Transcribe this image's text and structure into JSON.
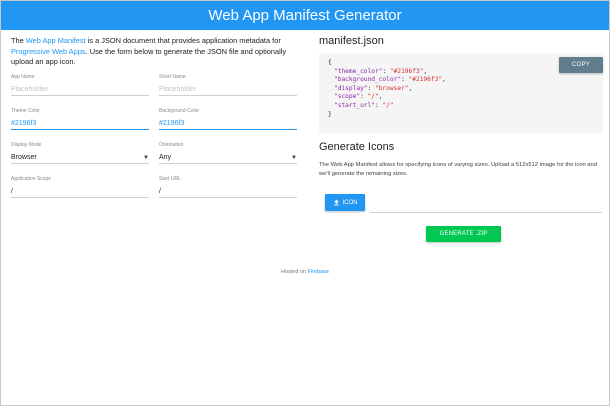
{
  "header": {
    "title": "Web App Manifest Generator"
  },
  "intro": {
    "part1": "The ",
    "link1": "Web App Manifest",
    "part2": " is a JSON document that provides application metadata for ",
    "link2": "Progressive Web Apps",
    "part3": ". Use the form below to generate the JSON file and optionally upload an app icon."
  },
  "form": {
    "app_name": {
      "label": "App Name",
      "placeholder": "Placeholder"
    },
    "short_name": {
      "label": "Short Name",
      "placeholder": "Placeholder"
    },
    "theme_color": {
      "label": "Theme Color",
      "value": "#2196f3"
    },
    "background_color": {
      "label": "Background Color",
      "value": "#2196f3"
    },
    "display_mode": {
      "label": "Display Mode",
      "value": "Browser"
    },
    "orientation": {
      "label": "Orientation",
      "value": "Any"
    },
    "application_scope": {
      "label": "Application Scope",
      "value": "/"
    },
    "start_url": {
      "label": "Start URL",
      "value": "/"
    }
  },
  "manifest": {
    "title": "manifest.json",
    "copy_label": "COPY",
    "open_brace": "{",
    "close_brace": "}",
    "lines": [
      {
        "key": "\"theme_color\"",
        "value": "\"#2196f3\""
      },
      {
        "key": "\"background_color\"",
        "value": "\"#2196f3\""
      },
      {
        "key": "\"display\"",
        "value": "\"browser\""
      },
      {
        "key": "\"scope\"",
        "value": "\"/\""
      },
      {
        "key": "\"start_url\"",
        "value": "\"/\""
      }
    ]
  },
  "icons": {
    "title": "Generate Icons",
    "description": "The Web App Manifest allows for specifying icons of varying sizes. Upload a 512x512 image for the icon and we'll generate the remaining sizes.",
    "icon_button": "ICON",
    "generate_button": "GENERATE .ZIP"
  },
  "footer": {
    "prefix": "Hosted on ",
    "link": "Firebase"
  },
  "colors": {
    "primary": "#2196f3",
    "copy": "#607d8b",
    "generate": "#00c853"
  }
}
